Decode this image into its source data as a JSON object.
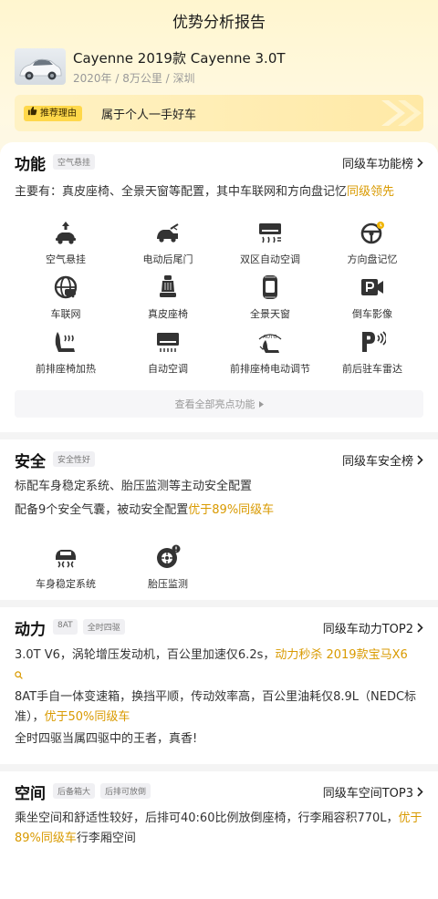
{
  "header": {
    "title": "优势分析报告"
  },
  "car": {
    "name": "Cayenne 2019款 Cayenne 3.0T",
    "meta": "2020年 / 8万公里 / 深圳"
  },
  "reason": {
    "tag": "推荐理由",
    "text": "属于个人一手好车"
  },
  "function": {
    "title": "功能",
    "tags": [
      "空气悬挂"
    ],
    "rank_link": "同级车功能榜",
    "desc_prefix": "主要有：真皮座椅、全景天窗等配置，其中车联网和方向盘记忆",
    "desc_highlight": "同级领先",
    "features": [
      {
        "label": "空气悬挂",
        "icon": "air-suspension-icon"
      },
      {
        "label": "电动后尾门",
        "icon": "electric-tailgate-icon"
      },
      {
        "label": "双区自动空调",
        "icon": "dual-zone-ac-icon"
      },
      {
        "label": "方向盘记忆",
        "icon": "steering-memory-icon"
      },
      {
        "label": "车联网",
        "icon": "connected-car-icon"
      },
      {
        "label": "真皮座椅",
        "icon": "leather-seat-icon"
      },
      {
        "label": "全景天窗",
        "icon": "panoramic-sunroof-icon"
      },
      {
        "label": "倒车影像",
        "icon": "reverse-camera-icon"
      },
      {
        "label": "前排座椅加热",
        "icon": "seat-heating-icon"
      },
      {
        "label": "自动空调",
        "icon": "auto-ac-icon"
      },
      {
        "label": "前排座椅电动调节",
        "icon": "power-seat-icon"
      },
      {
        "label": "前后驻车雷达",
        "icon": "parking-radar-icon"
      }
    ],
    "view_all": "查看全部亮点功能"
  },
  "safety": {
    "title": "安全",
    "tags": [
      "安全性好"
    ],
    "rank_link": "同级车安全榜",
    "line1": "标配车身稳定系统、胎压监测等主动安全配置",
    "line2_prefix": "配备9个安全气囊，被动安全配置",
    "line2_highlight": "优于89%同级车",
    "features": [
      {
        "label": "车身稳定系统",
        "icon": "stability-control-icon"
      },
      {
        "label": "胎压监测",
        "icon": "tire-pressure-icon"
      }
    ]
  },
  "power": {
    "title": "动力",
    "tags": [
      "8AT",
      "全时四驱"
    ],
    "rank_link": "同级车动力TOP2",
    "line1_prefix": "3.0T V6，涡轮增压发动机，百公里加速仅6.2s，",
    "line1_highlight": "动力秒杀 2019款宝马X6",
    "line2_prefix": "8AT手自一体变速箱，换挡平顺，传动效率高，百公里油耗仅8.9L（NEDC标准），",
    "line2_highlight": "优于50%同级车",
    "line3": "全时四驱当属四驱中的王者，真香!"
  },
  "space": {
    "title": "空间",
    "tags": [
      "后备箱大",
      "后排可放倒"
    ],
    "rank_link": "同级车空间TOP3",
    "line_prefix": "乘坐空间和舒适性较好，后排可40:60比例放倒座椅，行李厢容积770L，",
    "line_highlight": "优于89%同级车",
    "line_suffix": "行李厢空间"
  },
  "colors": {
    "accent": "#d99a00",
    "tag_yellow": "#ffd84a"
  }
}
